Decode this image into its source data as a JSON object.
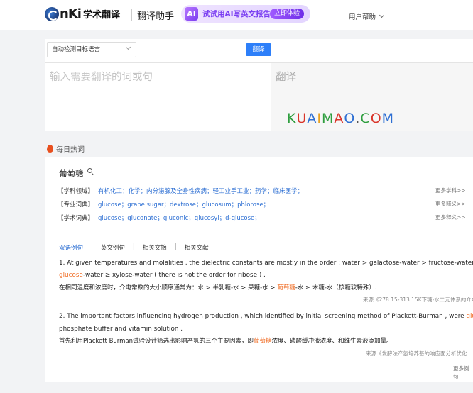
{
  "header": {
    "logo_mark": "cnki",
    "logo_text": "nKi",
    "logo_title": "学术翻译",
    "sub_title": "翻译助手",
    "promo": {
      "icon": "AI",
      "text": "试试用AI写英文报告",
      "button": "立即体验"
    },
    "user_help": "用户帮助"
  },
  "translator": {
    "language_select": "自动检测目标语言",
    "translate_button": "翻译",
    "source_placeholder": "输入需要翻译的词或句",
    "target_label": "翻译",
    "watermark": "KUAIMAO.COM"
  },
  "hot": {
    "title": "每日热词"
  },
  "result": {
    "word": "葡萄糖",
    "dict_rows": [
      {
        "tag": "【学科领域】",
        "items": "有机化工；化学；内分泌腺及全身性疾病；轻工业手工业；药学；临床医学；",
        "more": "更多学科>>"
      },
      {
        "tag": "【专业词典】",
        "items": "glucose；grape sugar；dextrose；glucosum；phlorose；",
        "more": "更多释义>>"
      },
      {
        "tag": "【学术词典】",
        "items": "glucose；gluconate；gluconic；glucosyl；d-glucose；",
        "more": "更多释义>>"
      }
    ],
    "tabs": [
      "双语例句",
      "英文例句",
      "相关文摘",
      "相关文献"
    ],
    "tab_sep": "|",
    "examples": [
      {
        "en_1": "1. At given temperatures and molalities , the dielectric constants are mostly in the order : water > galactose-water > fructose-water >",
        "en_2_hl": "glucose",
        "en_2_rest": "-water ≥ xylose-water ( there is not the order for ribose ) .",
        "zh_pre": "在相同温度和浓度时，介电常数的大小顺序通常为：水 > 半乳糖-水 > 果糖-水 > ",
        "zh_hl": "葡萄糖",
        "zh_post": "-水 ≥ 木糖-水（核糖较特殊）.",
        "source": "来源《278.15-313.15K下糖-水二元体系的介电常数"
      },
      {
        "en_1": "2. The important factors influencing hydrogen production , which identified by initial screening method of Plackett-Burman , were ",
        "en_1_hl": "glucos",
        "en_2": "phosphate buffer and vitamin solution .",
        "zh_pre": "首先利用Plackett Burman试验设计筛选出影响产氢的三个主要因素，即",
        "zh_hl": "葡萄糖",
        "zh_post": "浓度、磷酸缓冲液浓度、和维生素液添加量。",
        "source": "来源《发酵法产氢培养基的响应面分析优化"
      }
    ],
    "more_examples": "更多例句"
  },
  "colors": {
    "accent": "#2d7ff9",
    "highlight": "#f06a20",
    "link": "#2d6fd3",
    "promo": "#7b3ff2"
  }
}
